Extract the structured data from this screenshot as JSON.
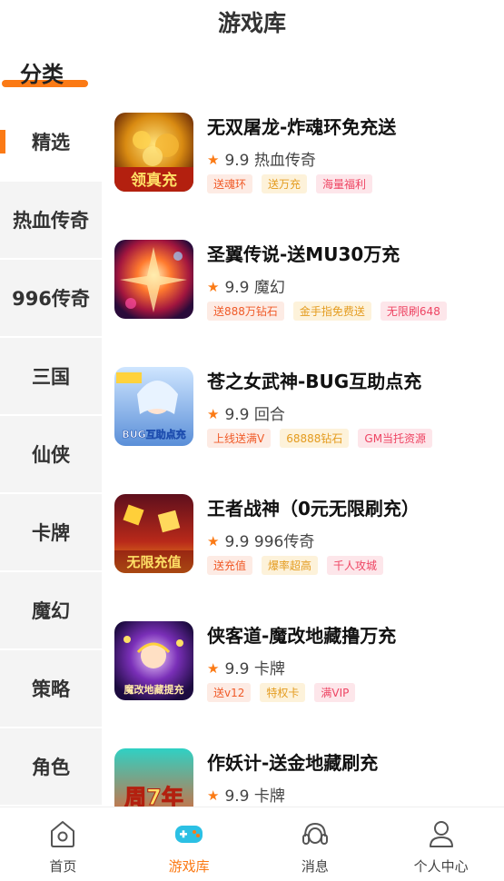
{
  "header": {
    "title": "游戏库"
  },
  "category_heading": "分类",
  "colors": {
    "accent": "#fb7a15",
    "star": "#fb7a15",
    "sidebar_bg": "#f4f4f4"
  },
  "sidebar": {
    "items": [
      {
        "label": "精选",
        "active": true
      },
      {
        "label": "热血传奇",
        "active": false
      },
      {
        "label": "996传奇",
        "active": false
      },
      {
        "label": "三国",
        "active": false
      },
      {
        "label": "仙侠",
        "active": false
      },
      {
        "label": "卡牌",
        "active": false
      },
      {
        "label": "魔幻",
        "active": false
      },
      {
        "label": "策略",
        "active": false
      },
      {
        "label": "角色",
        "active": false
      }
    ]
  },
  "games": [
    {
      "title": "无双屠龙-炸魂环免充送",
      "rating": "9.9",
      "genre": "热血传奇",
      "tags": [
        "送魂环",
        "送万充",
        "海量福利"
      ],
      "thumb_text": "领真充"
    },
    {
      "title": "圣翼传说-送MU30万充",
      "rating": "9.9",
      "genre": "魔幻",
      "tags": [
        "送888万钻石",
        "金手指免费送",
        "无限刷648"
      ],
      "thumb_text": ""
    },
    {
      "title": "苍之女武神-BUG互助点充",
      "rating": "9.9",
      "genre": "回合",
      "tags": [
        "上线送满V",
        "68888钻石",
        "GM当托资源"
      ],
      "thumb_text": "BUG互助点充"
    },
    {
      "title": "王者战神（0元无限刷充）",
      "rating": "9.9",
      "genre": "996传奇",
      "tags": [
        "送充值",
        "爆率超高",
        "千人攻城"
      ],
      "thumb_text": "无限充值"
    },
    {
      "title": "侠客道-魔改地藏撸万充",
      "rating": "9.9",
      "genre": "卡牌",
      "tags": [
        "送v12",
        "特权卡",
        "满VIP"
      ],
      "thumb_text": "魔改地藏提充"
    },
    {
      "title": "作妖计-送金地藏刷充",
      "rating": "9.9",
      "genre": "卡牌",
      "tags": [],
      "thumb_text": "周7年"
    }
  ],
  "bottom_nav": {
    "items": [
      {
        "label": "首页",
        "icon": "home-icon",
        "active": false
      },
      {
        "label": "游戏库",
        "icon": "gamepad-icon",
        "active": true
      },
      {
        "label": "消息",
        "icon": "headset-icon",
        "active": false
      },
      {
        "label": "个人中心",
        "icon": "user-icon",
        "active": false
      }
    ]
  }
}
